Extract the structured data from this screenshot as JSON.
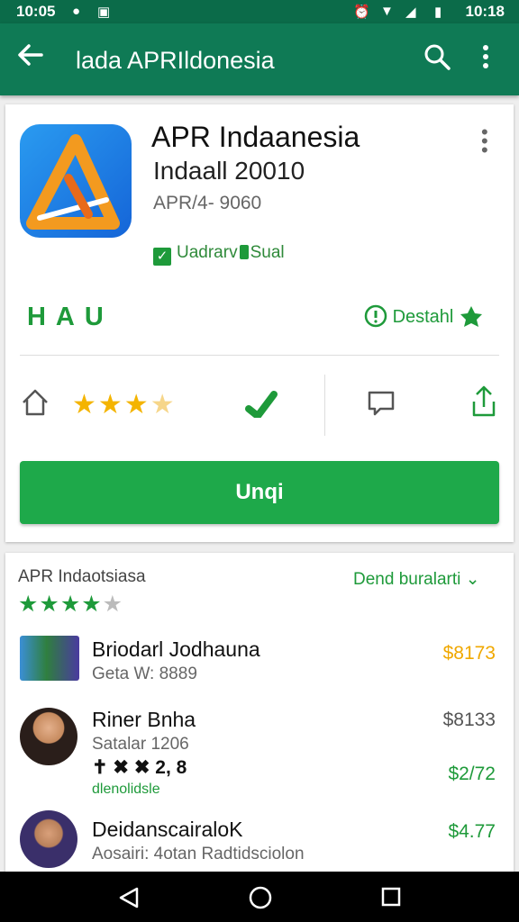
{
  "status_bar": {
    "time": "10:05",
    "clock": "10:18"
  },
  "app_bar": {
    "title": "lada APRIldonesia"
  },
  "app": {
    "name": "APR Indaanesia",
    "developer": "Indaall 20010",
    "version": "APR/4- 9060",
    "badge_label": "Uadrarv",
    "badge_suffix": "Sual",
    "tag_left": "H A U",
    "tag_right": "Destahl",
    "install_label": "Unqi",
    "rating_stars": 3.5
  },
  "reviews": {
    "title": "APR Indaotsiasa",
    "link": "Dend buralarti",
    "rating_stars": 4,
    "items": [
      {
        "name": "Briodarl Jodhauna",
        "sub": "Geta W: 8889",
        "price": "$8173",
        "price_color": "#f0a800"
      },
      {
        "name": "Riner Bnha",
        "sub": "Satalar 1206",
        "sub2": "✝ ✖ ✖ 2, 8",
        "note": "dlenolidsle",
        "price": "$8133",
        "price2": "$2/72",
        "price_color": "#555555",
        "price2_color": "#1e9a3a"
      },
      {
        "name": "DeidanscairaloK",
        "sub": "Aosairi: 4otan Radtidsciolon",
        "price": "$4.77",
        "price_color": "#1e9a3a"
      }
    ]
  },
  "colors": {
    "primary": "#0f7a55",
    "accent": "#1ea94a",
    "star": "#f4b400"
  }
}
